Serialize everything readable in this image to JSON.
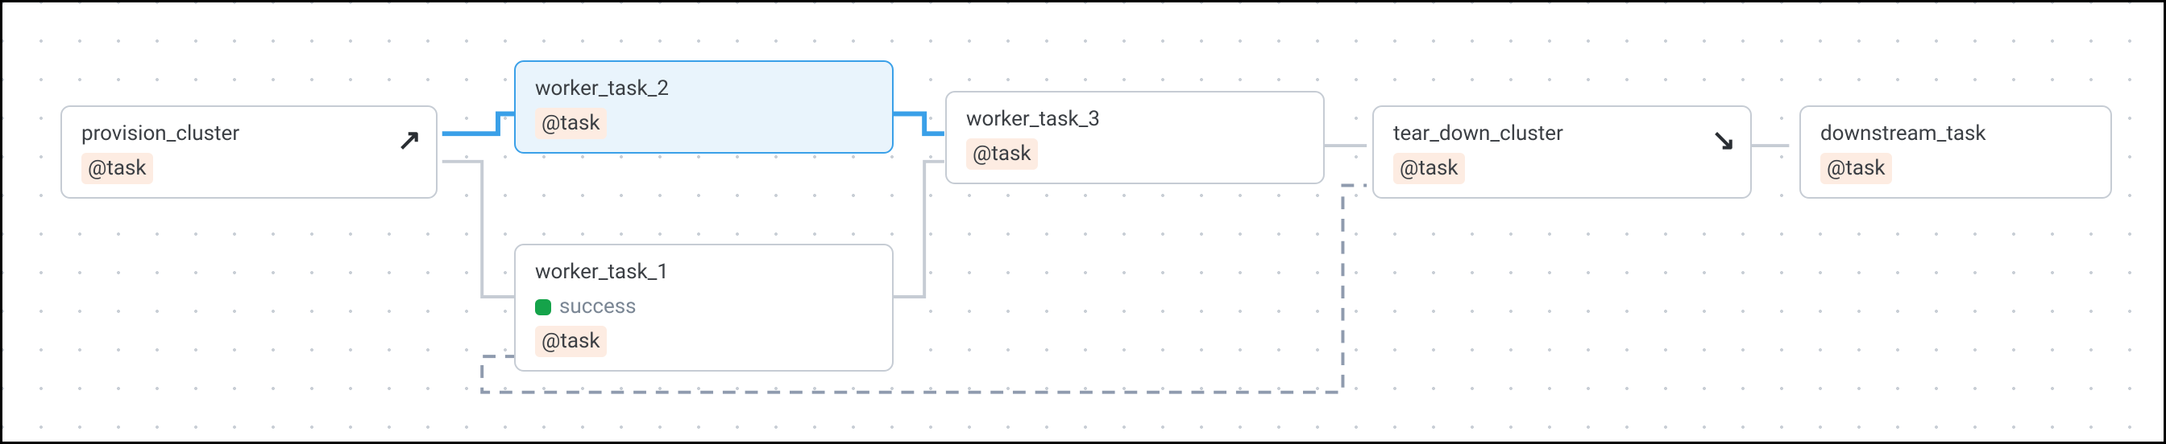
{
  "colors": {
    "selected_border": "#3aa0e8",
    "selected_bg": "#e9f4fc",
    "edge_highlight": "#3aa0e8",
    "edge_default": "#c6ccd4",
    "success": "#15a34a"
  },
  "nodes": {
    "provision_cluster": {
      "title": "provision_cluster",
      "badge": "@task",
      "arrow": "↗"
    },
    "worker_task_2": {
      "title": "worker_task_2",
      "badge": "@task",
      "selected": true
    },
    "worker_task_3": {
      "title": "worker_task_3",
      "badge": "@task"
    },
    "worker_task_1": {
      "title": "worker_task_1",
      "badge": "@task",
      "status": {
        "state": "success",
        "label": "success"
      }
    },
    "tear_down_cluster": {
      "title": "tear_down_cluster",
      "badge": "@task",
      "arrow": "↘"
    },
    "downstream_task": {
      "title": "downstream_task",
      "badge": "@task"
    }
  },
  "edges": [
    {
      "from": "provision_cluster",
      "to": "worker_task_2",
      "style": "highlight"
    },
    {
      "from": "provision_cluster",
      "to": "worker_task_1",
      "style": "normal"
    },
    {
      "from": "worker_task_2",
      "to": "worker_task_3",
      "style": "highlight"
    },
    {
      "from": "worker_task_1",
      "to": "worker_task_3",
      "style": "normal"
    },
    {
      "from": "worker_task_3",
      "to": "tear_down_cluster",
      "style": "normal"
    },
    {
      "from": "worker_task_1",
      "to": "tear_down_cluster",
      "style": "dashed"
    },
    {
      "from": "tear_down_cluster",
      "to": "downstream_task",
      "style": "normal"
    }
  ]
}
